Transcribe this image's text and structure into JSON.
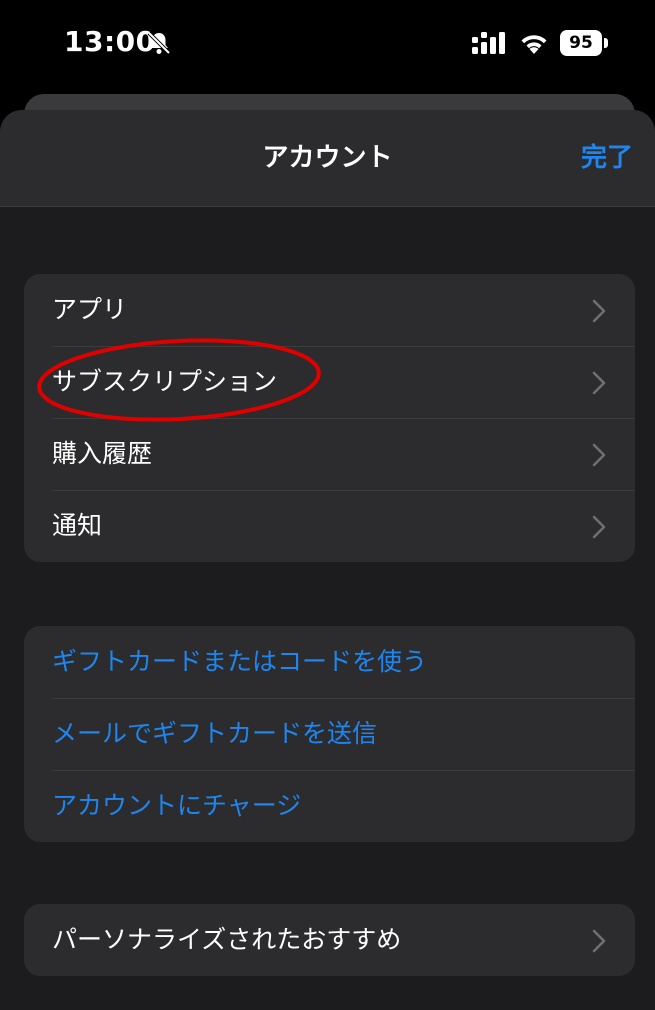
{
  "status_bar": {
    "time": "13:00",
    "battery": "95",
    "icons": [
      "bell-off-icon",
      "signal-icon",
      "wifi-icon",
      "battery-icon"
    ]
  },
  "nav": {
    "title": "アカウント",
    "done_label": "完了"
  },
  "group1": {
    "items": [
      {
        "label": "アプリ"
      },
      {
        "label": "サブスクリプション"
      },
      {
        "label": "購入履歴"
      },
      {
        "label": "通知"
      }
    ]
  },
  "group2": {
    "items": [
      {
        "label": "ギフトカードまたはコードを使う"
      },
      {
        "label": "メールでギフトカードを送信"
      },
      {
        "label": "アカウントにチャージ"
      }
    ]
  },
  "group3": {
    "items": [
      {
        "label": "パーソナライズされたおすすめ"
      }
    ]
  },
  "colors": {
    "accent": "#1e86ee",
    "background": "#000000",
    "cell": "#2c2c2e",
    "annotation": "#e00000"
  }
}
